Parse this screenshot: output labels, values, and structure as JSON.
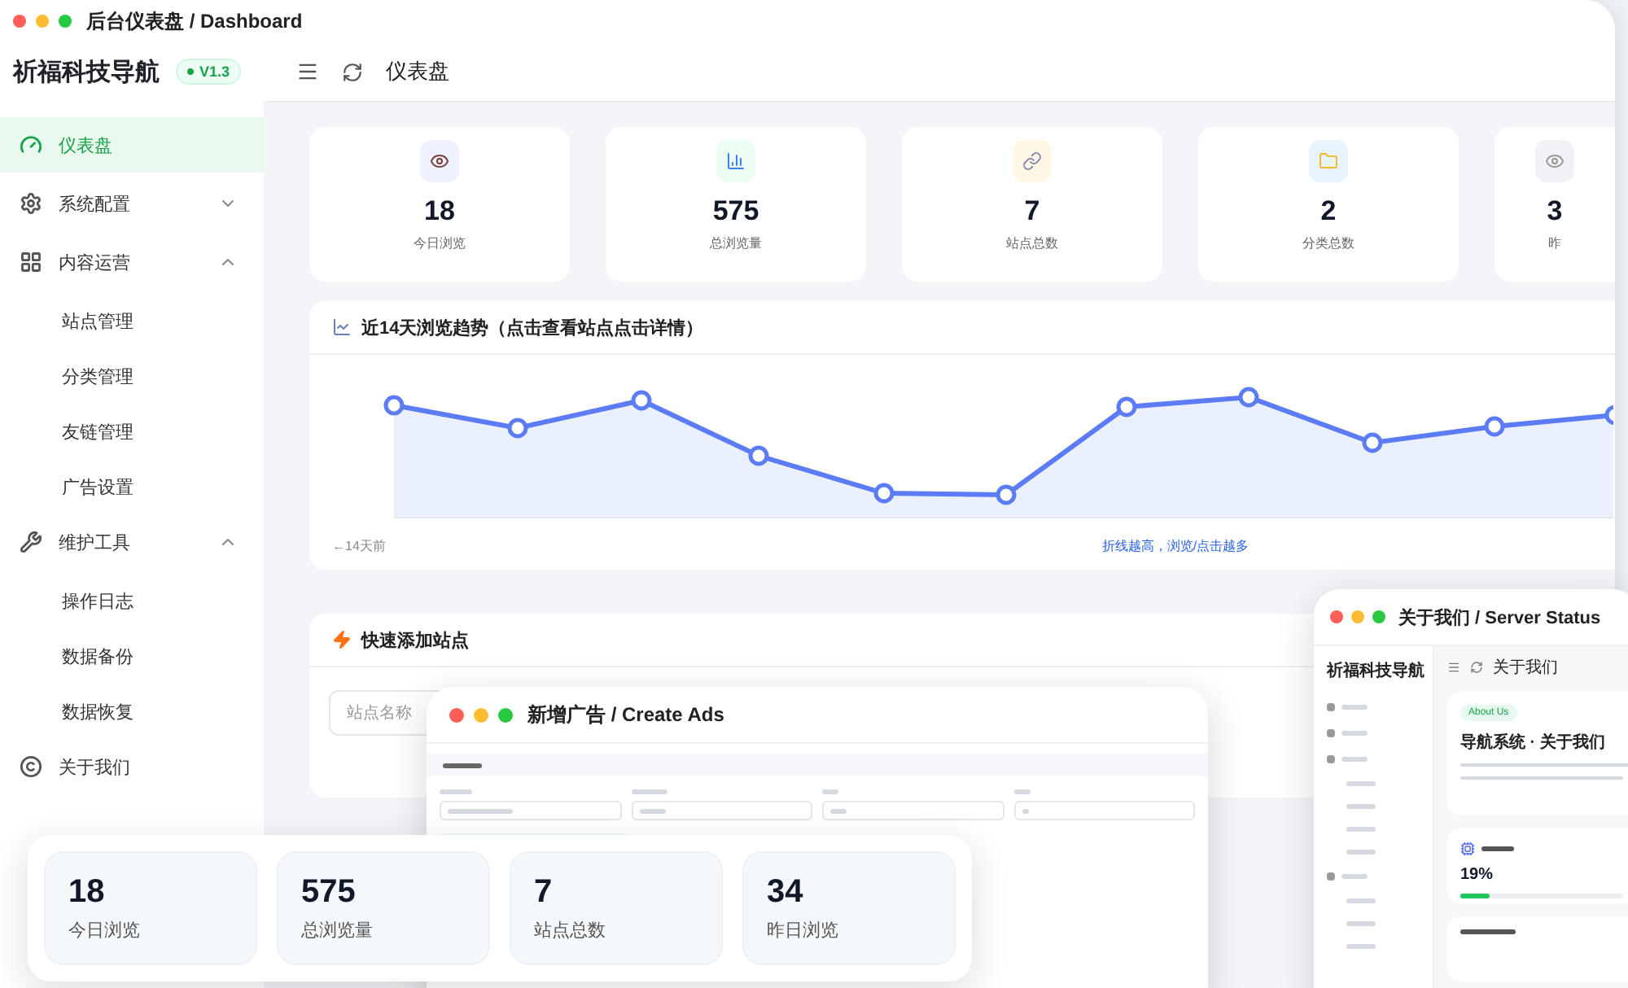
{
  "window": {
    "title": "后台仪表盘 / Dashboard"
  },
  "sidebar": {
    "brand": "祈福科技导航",
    "version": "V1.3",
    "items": [
      {
        "label": "仪表盘",
        "kind": "link",
        "selected": true
      },
      {
        "label": "系统配置",
        "kind": "group",
        "selected": false,
        "expanded": false
      },
      {
        "label": "内容运营",
        "kind": "group",
        "selected": false,
        "expanded": true,
        "children": [
          {
            "label": "站点管理",
            "selected": false
          },
          {
            "label": "分类管理",
            "selected": false
          },
          {
            "label": "友链管理",
            "selected": false
          },
          {
            "label": "广告设置",
            "selected": false
          }
        ]
      },
      {
        "label": "维护工具",
        "kind": "group",
        "selected": false,
        "expanded": true,
        "children": [
          {
            "label": "操作日志",
            "selected": false
          },
          {
            "label": "数据备份",
            "selected": false
          },
          {
            "label": "数据恢复",
            "selected": false
          }
        ]
      },
      {
        "label": "关于我们",
        "kind": "link",
        "selected": false
      }
    ]
  },
  "header": {
    "title": "仪表盘"
  },
  "stats": [
    {
      "value": "18",
      "label": "今日浏览"
    },
    {
      "value": "575",
      "label": "总浏览量"
    },
    {
      "value": "7",
      "label": "站点总数"
    },
    {
      "value": "2",
      "label": "分类总数"
    },
    {
      "value": "3",
      "label": "昨"
    }
  ],
  "trend_card": {
    "title": "近14天浏览趋势（点击查看站点点击详情）",
    "start_label": "←14天前",
    "hint": "折线越高，浏览/点击越多"
  },
  "quick_add": {
    "title": "快速添加站点",
    "placeholder": "站点名称"
  },
  "ads_window": {
    "title": "新增广告 / Create Ads"
  },
  "status_window": {
    "title": "关于我们 / Server Status",
    "brand": "祈福科技导航",
    "header": "关于我们",
    "badge": "About Us",
    "heading": "导航系统 · 关于我们",
    "cpu": {
      "reading": "19%",
      "level": 0.18
    }
  },
  "summary": [
    {
      "value": "18",
      "label": "今日浏览"
    },
    {
      "value": "575",
      "label": "总浏览量"
    },
    {
      "value": "7",
      "label": "站点总数"
    },
    {
      "value": "34",
      "label": "昨日浏览"
    }
  ]
}
